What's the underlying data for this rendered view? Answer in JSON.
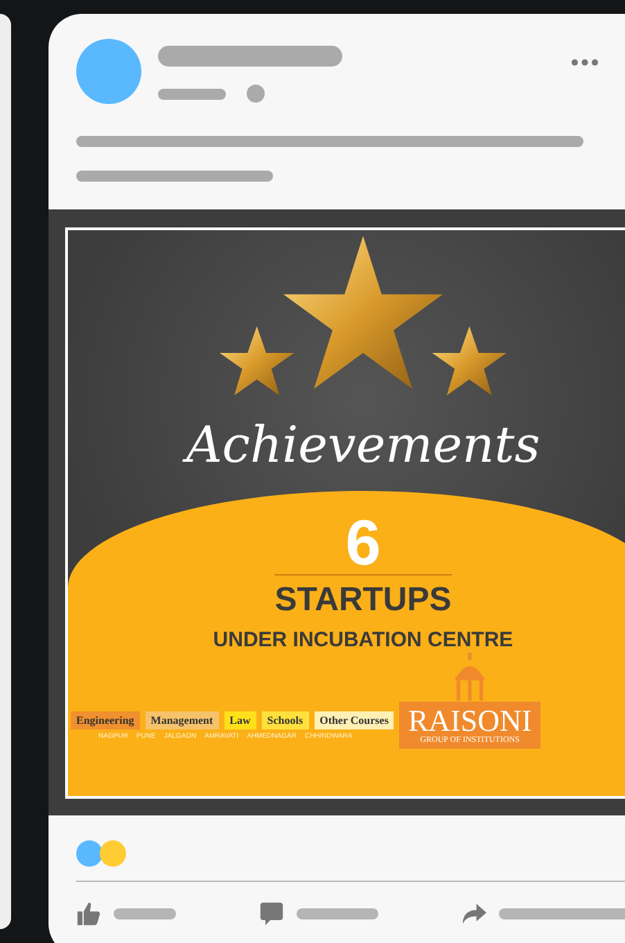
{
  "poster": {
    "title": "Achievements",
    "number": "6",
    "headline": "STARTUPS",
    "subline": "UNDER INCUBATION CENTRE",
    "courses": [
      {
        "label": "Engineering",
        "color": "#f0902e"
      },
      {
        "label": "Management",
        "color": "#f6c36a"
      },
      {
        "label": "Law",
        "color": "#ffe01a"
      },
      {
        "label": "Schools",
        "color": "#ffe03c"
      },
      {
        "label": "Other Courses",
        "color": "#fff0b4"
      }
    ],
    "cities": [
      "NAGPUR",
      "PUNE",
      "JALGAON",
      "AMRAVATI",
      "AHMEDNAGAR",
      "CHHINDWARA"
    ],
    "brand": "RAISONI",
    "brand_sub": "GROUP OF INSTITUTIONS"
  },
  "reactions": [
    {
      "color": "#5ab8ff"
    },
    {
      "color": "#ffcc33"
    }
  ]
}
